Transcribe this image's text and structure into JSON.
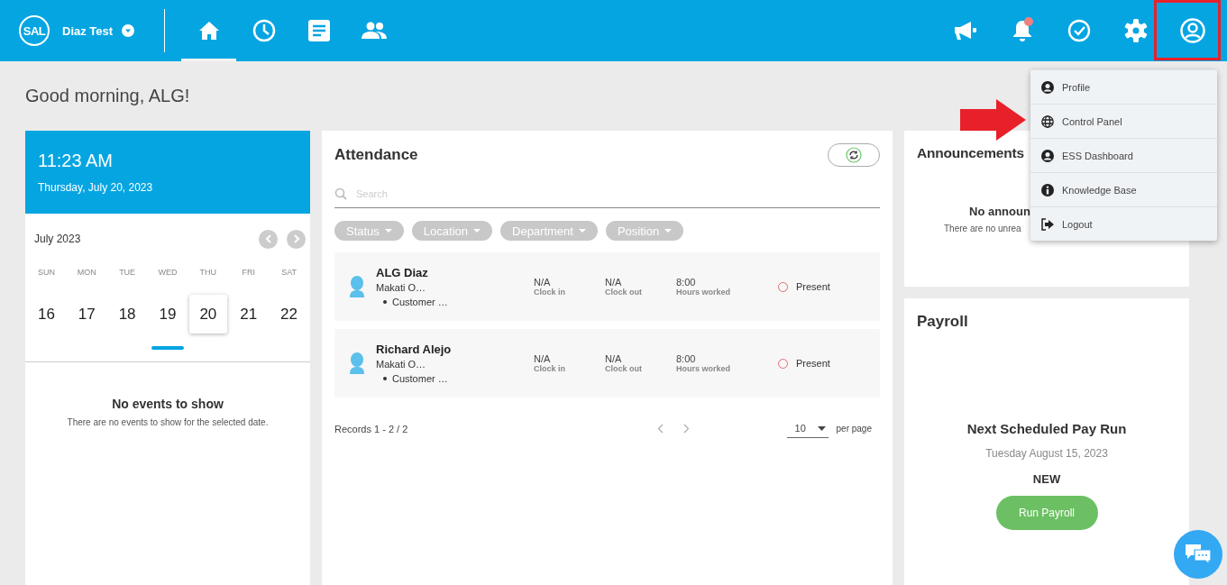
{
  "topbar": {
    "logo": "SAL",
    "company": "Diaz Test",
    "nav": [
      {
        "kind": "home",
        "selected": true
      },
      {
        "kind": "clock",
        "selected": false
      },
      {
        "kind": "document",
        "selected": false
      },
      {
        "kind": "people",
        "selected": false
      }
    ],
    "actions": [
      {
        "kind": "megaphone",
        "badge": false
      },
      {
        "kind": "bell",
        "badge": true
      },
      {
        "kind": "check",
        "badge": false
      },
      {
        "kind": "gear",
        "badge": false
      },
      {
        "kind": "user",
        "badge": false
      }
    ]
  },
  "greeting": "Good morning, ALG!",
  "clock": {
    "time": "11:23 AM",
    "date": "Thursday, July 20, 2023"
  },
  "calendar": {
    "month": "July 2023",
    "weekdays": [
      "SUN",
      "MON",
      "TUE",
      "WED",
      "THU",
      "FRI",
      "SAT"
    ],
    "days": [
      {
        "label": "16",
        "selected": false,
        "has_events": false
      },
      {
        "label": "17",
        "selected": false,
        "has_events": false
      },
      {
        "label": "18",
        "selected": false,
        "has_events": false
      },
      {
        "label": "19",
        "selected": false,
        "has_events": true
      },
      {
        "label": "20",
        "selected": true,
        "has_events": false
      },
      {
        "label": "21",
        "selected": false,
        "has_events": false
      },
      {
        "label": "22",
        "selected": false,
        "has_events": false
      }
    ]
  },
  "events": {
    "title": "No events to show",
    "text": "There are no events to show for the selected date."
  },
  "attendance": {
    "title": "Attendance",
    "search": {
      "placeholder": "Search"
    },
    "filters": [
      "Status",
      "Location",
      "Department",
      "Position"
    ],
    "rows": [
      {
        "name": "ALG Diaz",
        "location": "Makati O…",
        "department": "Customer …",
        "clock_in": "N/A",
        "clock_in_label": "Clock in",
        "clock_out": "N/A",
        "clock_out_label": "Clock out",
        "hours": "8:00",
        "hours_label": "Hours worked",
        "status": "Present"
      },
      {
        "name": "Richard Alejo",
        "location": "Makati O…",
        "department": "Customer …",
        "clock_in": "N/A",
        "clock_in_label": "Clock in",
        "clock_out": "N/A",
        "clock_out_label": "Clock out",
        "hours": "8:00",
        "hours_label": "Hours worked",
        "status": "Present"
      }
    ],
    "records": "Records 1 - 2 / 2",
    "per_page": {
      "value": "10",
      "label": "per page"
    }
  },
  "announcements": {
    "title": "Announcements",
    "empty_title": "No announ",
    "empty_text": "There are no unrea"
  },
  "payroll": {
    "title": "Payroll",
    "next_title": "Next Scheduled Pay Run",
    "date": "Tuesday August 15, 2023",
    "status": "NEW",
    "button": "Run Payroll"
  },
  "user_menu": {
    "items": [
      {
        "kind": "user",
        "label": "Profile"
      },
      {
        "kind": "globe",
        "label": "Control Panel"
      },
      {
        "kind": "user",
        "label": "ESS Dashboard"
      },
      {
        "kind": "info",
        "label": "Knowledge Base"
      },
      {
        "kind": "logout",
        "label": "Logout"
      }
    ]
  }
}
